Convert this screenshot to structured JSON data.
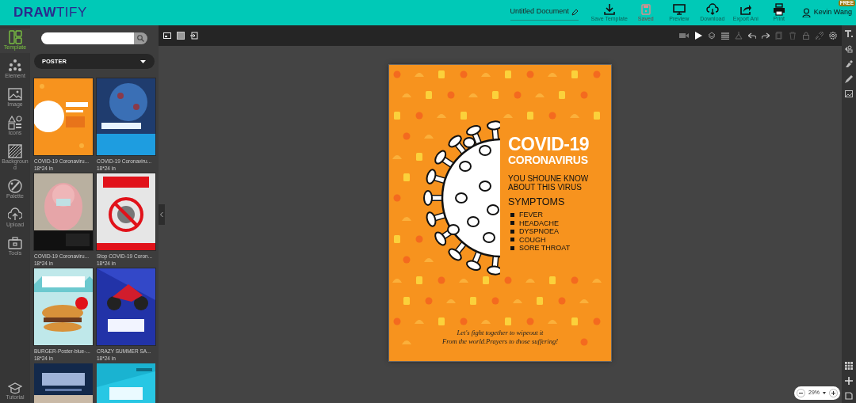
{
  "app": {
    "logo": "DRAWTIFY",
    "document_title": "Untitled Document",
    "user": {
      "name": "Kevin Wang",
      "badge": "FREE"
    }
  },
  "actions": [
    {
      "label": "Save Template",
      "disabled": false
    },
    {
      "label": "Saved",
      "disabled": true
    },
    {
      "label": "Preview",
      "disabled": false
    },
    {
      "label": "Download",
      "disabled": false
    },
    {
      "label": "Export Ani",
      "disabled": false
    },
    {
      "label": "Print",
      "disabled": false
    }
  ],
  "rail": [
    {
      "label": "Template",
      "selected": true
    },
    {
      "label": "Element",
      "selected": false
    },
    {
      "label": "Image",
      "selected": false
    },
    {
      "label": "Icons",
      "selected": false
    },
    {
      "label": "Background",
      "selected": false
    },
    {
      "label": "Palette",
      "selected": false
    },
    {
      "label": "Upload",
      "selected": false
    },
    {
      "label": "Tools",
      "selected": false
    }
  ],
  "tutorial": {
    "label": "Tutorial"
  },
  "category": {
    "value": "POSTER"
  },
  "templates": [
    {
      "title": "COVID-19 Coronaviru...",
      "size": "18*24 in"
    },
    {
      "title": "COVID-19 Coronaviru...",
      "size": "18*24 in"
    },
    {
      "title": "COVID-19 Coronaviru...",
      "size": "18*24 in"
    },
    {
      "title": "Stop COVID-19 Coron...",
      "size": "18*24 in"
    },
    {
      "title": "BURGER-Poster-blue-...",
      "size": "18*24 in"
    },
    {
      "title": "CRAZY SUMMER SA...",
      "size": "18*24 in"
    },
    {
      "kind": "picture"
    },
    {
      "kind": "picture"
    }
  ],
  "poster": {
    "title": "COVID-19",
    "subtitle": "CORONAVIRUS",
    "intro": [
      "YOU SHOUNE KNOW",
      "ABOUT THIS VIRUS"
    ],
    "symptoms_heading": "SYMPTOMS",
    "symptoms": [
      "FEVER",
      "HEADACHE",
      "DYSPNOEA",
      "COUGH",
      "SORE THROAT"
    ],
    "footer": [
      "Let's fight together to wipeout it",
      "From the world.Prayers to those suffering!"
    ]
  },
  "zoom": {
    "reading": "29%"
  }
}
